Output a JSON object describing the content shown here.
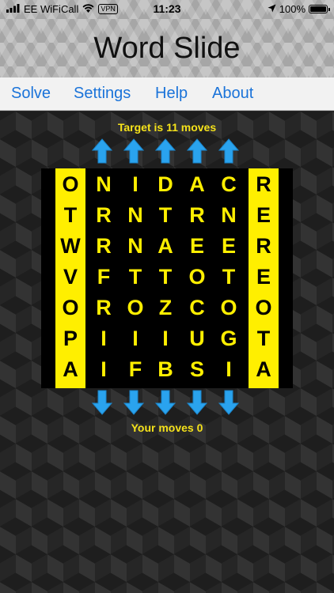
{
  "status": {
    "carrier": "EE WiFiCall",
    "vpn": "VPN",
    "time": "11:23",
    "battery": "100%",
    "battery_level": 1.0
  },
  "app": {
    "title": "Word Slide"
  },
  "menu": {
    "items": [
      {
        "label": "Solve"
      },
      {
        "label": "Settings"
      },
      {
        "label": "Help"
      },
      {
        "label": "About"
      }
    ]
  },
  "game": {
    "target_text": "Target is 11 moves",
    "moves_text": "Your moves 0",
    "left_column": [
      "O",
      "T",
      "W",
      "V",
      "O",
      "P",
      "A"
    ],
    "right_column": [
      "R",
      "E",
      "R",
      "E",
      "O",
      "T",
      "A"
    ],
    "main_grid": [
      [
        "N",
        "I",
        "D",
        "A",
        "C"
      ],
      [
        "R",
        "N",
        "T",
        "R",
        "N"
      ],
      [
        "R",
        "N",
        "A",
        "E",
        "E"
      ],
      [
        "F",
        "T",
        "T",
        "O",
        "T"
      ],
      [
        "R",
        "O",
        "Z",
        "C",
        "O"
      ],
      [
        "I",
        "I",
        "I",
        "U",
        "G"
      ],
      [
        "I",
        "F",
        "B",
        "S",
        "I"
      ]
    ],
    "colors": {
      "yellow": "#ffef00",
      "arrow_blue": "#2aa3ee",
      "menu_blue": "#1a73d9"
    }
  }
}
